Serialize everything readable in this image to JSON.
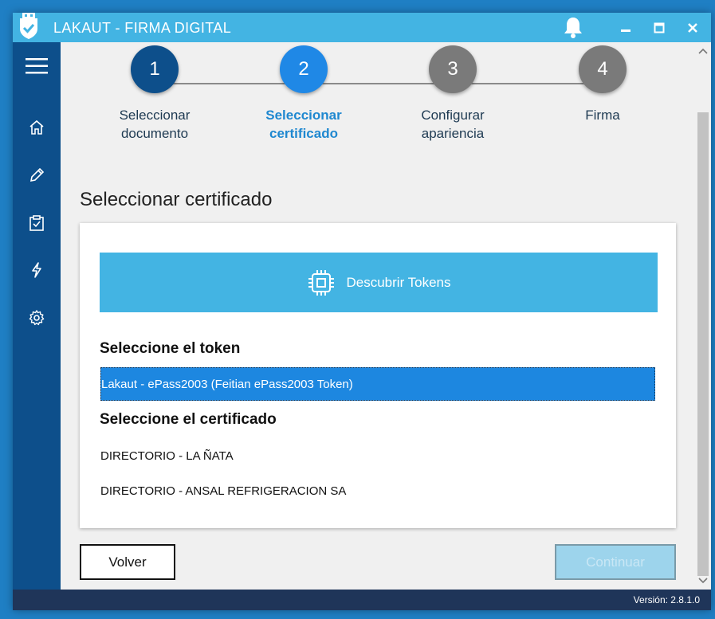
{
  "window": {
    "title": "LAKAUT - FIRMA DIGITAL"
  },
  "titlebar": {
    "icons": [
      "app-shield-logo",
      "bell-icon",
      "minimize-icon",
      "maximize-icon",
      "close-icon"
    ]
  },
  "sidebar": {
    "items": [
      {
        "icon": "hamburger-menu-icon"
      },
      {
        "icon": "home-icon"
      },
      {
        "icon": "pencil-icon"
      },
      {
        "icon": "clipboard-check-icon"
      },
      {
        "icon": "bolt-icon"
      },
      {
        "icon": "gear-icon"
      }
    ]
  },
  "stepper": {
    "steps": [
      {
        "number": "1",
        "label": "Seleccionar\ndocumento",
        "state": "completed"
      },
      {
        "number": "2",
        "label": "Seleccionar\ncertificado",
        "state": "active"
      },
      {
        "number": "3",
        "label": "Configurar\napariencia",
        "state": "pending"
      },
      {
        "number": "4",
        "label": "Firma",
        "state": "pending"
      }
    ]
  },
  "main": {
    "title": "Seleccionar certificado",
    "discover_button": "Descubrir Tokens",
    "token_label": "Seleccione el token",
    "tokens": [
      "Lakaut - ePass2003 (Feitian ePass2003 Token)"
    ],
    "certificate_label": "Seleccione el certificado",
    "certificates": [
      "DIRECTORIO - LA ÑATA",
      "DIRECTORIO - ANSAL REFRIGERACION SA"
    ]
  },
  "buttons": {
    "back": "Volver",
    "continue": "Continuar"
  },
  "status": {
    "version": "Versión: 2.8.1.0"
  },
  "colors": {
    "titlebar": "#43b4e3",
    "sidebar": "#0d4f8b",
    "step_completed": "#0d4f8b",
    "step_active": "#1f88e6",
    "step_pending": "#7a7a7a",
    "selected": "#1d87e0",
    "statusbar": "#1f3559"
  }
}
